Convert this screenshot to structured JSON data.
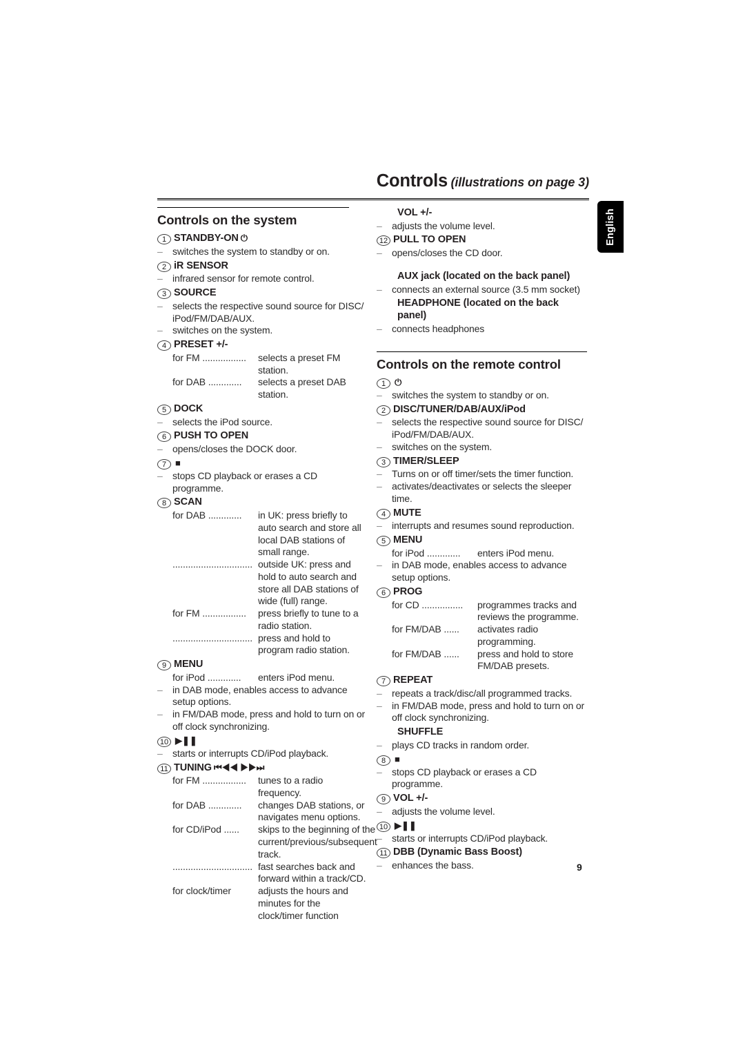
{
  "header": {
    "title": "Controls",
    "subtitle": "(illustrations on page 3)"
  },
  "language_tab": {
    "label": "English"
  },
  "page_number": "9",
  "left_column": {
    "section_title": "Controls on the system",
    "entries": [
      {
        "num": "1",
        "label": "STANDBY-ON",
        "glyph": "⏻",
        "lines": [
          {
            "dash": "–",
            "text": "switches the system to standby or on."
          }
        ]
      },
      {
        "num": "2",
        "label": "iR SENSOR",
        "lines": [
          {
            "dash": "–",
            "text": "infrared sensor for remote control."
          }
        ]
      },
      {
        "num": "3",
        "label": "SOURCE",
        "lines": [
          {
            "dash": "–",
            "text": "selects the respective sound source for DISC/ iPod/FM/DAB/AUX."
          },
          {
            "dash": "–",
            "text": "switches on the system."
          }
        ]
      },
      {
        "num": "4",
        "label": "PRESET +/-",
        "leaders": [
          {
            "term": "for FM .................",
            "desc": "selects a preset FM station."
          },
          {
            "term": "for DAB .............",
            "desc": "selects a preset DAB station."
          }
        ]
      },
      {
        "num": "5",
        "label": "DOCK",
        "lines": [
          {
            "dash": "–",
            "text": "selects the iPod source."
          }
        ]
      },
      {
        "num": "6",
        "label": "PUSH TO OPEN",
        "lines": [
          {
            "dash": "–",
            "text": "opens/closes the DOCK door."
          }
        ]
      },
      {
        "num": "7",
        "label": "",
        "glyph": "■",
        "lines": [
          {
            "dash": "–",
            "text": "stops CD playback or erases a CD programme."
          }
        ]
      },
      {
        "num": "8",
        "label": "SCAN",
        "leaders": [
          {
            "term": "for DAB .............",
            "desc": "in UK: press briefly to auto search and store all local DAB stations of small range."
          },
          {
            "term": "...............................",
            "desc": "outside UK: press and hold to auto search and store all DAB stations of wide (full) range."
          },
          {
            "term": "for FM .................",
            "desc": "press briefly to tune to a radio station."
          },
          {
            "term": "...............................",
            "desc": "press and hold to program radio station."
          }
        ]
      },
      {
        "num": "9",
        "label": "MENU",
        "leaders": [
          {
            "term": "for iPod .............",
            "desc": "enters iPod menu."
          }
        ],
        "lines": [
          {
            "dash": "–",
            "text": "in DAB mode, enables access to advance setup options."
          },
          {
            "dash": "–",
            "text": "in FM/DAB mode, press and hold to turn on or off clock synchronizing."
          }
        ]
      },
      {
        "num": "10",
        "label": "",
        "glyph": "▶❚❚",
        "lines": [
          {
            "dash": "–",
            "text": "starts or interrupts CD/iPod playback."
          }
        ]
      },
      {
        "num": "11",
        "label": "TUNING",
        "glyph": "⏮◀◀  ▶▶⏭",
        "leaders": [
          {
            "term": "for FM .................",
            "desc": "tunes to a radio frequency."
          },
          {
            "term": "for DAB .............",
            "desc": "changes DAB stations, or navigates menu options."
          },
          {
            "term": "for CD/iPod ......",
            "desc": "skips to the beginning of the current/previous/subsequent track."
          },
          {
            "term": "...............................",
            "desc": "fast searches back and forward within a track/CD."
          },
          {
            "term": "for clock/timer",
            "desc": "adjusts the hours and minutes for the clock/timer function"
          }
        ]
      }
    ]
  },
  "right_column": {
    "top_entries": [
      {
        "num": "",
        "label": "VOL +/-",
        "lines": [
          {
            "dash": "–",
            "text": "adjusts the volume level."
          }
        ]
      },
      {
        "num": "12",
        "label": "PULL TO OPEN",
        "lines": [
          {
            "dash": "–",
            "text": "opens/closes the CD door."
          }
        ]
      },
      {
        "num": "",
        "label": "AUX jack (located on the back panel)",
        "lines": [
          {
            "dash": "–",
            "text": "connects an external source (3.5 mm socket)"
          }
        ]
      },
      {
        "num": "",
        "label": "HEADPHONE (located on the back panel)",
        "lines": [
          {
            "dash": "–",
            "text": "connects headphones"
          }
        ]
      }
    ],
    "section_title": "Controls on the remote control",
    "entries": [
      {
        "num": "1",
        "label": "",
        "glyph": "⏻",
        "lines": [
          {
            "dash": "–",
            "text": "switches the system to standby or on."
          }
        ]
      },
      {
        "num": "2",
        "label": "DISC/TUNER/DAB/AUX/iPod",
        "lines": [
          {
            "dash": "–",
            "text": "selects the respective sound source for DISC/ iPod/FM/DAB/AUX."
          },
          {
            "dash": "–",
            "text": "switches on the system."
          }
        ]
      },
      {
        "num": "3",
        "label": "TIMER/SLEEP",
        "lines": [
          {
            "dash": "–",
            "text": "Turns on or off timer/sets the timer function."
          },
          {
            "dash": "–",
            "text": "activates/deactivates or selects the sleeper time."
          }
        ]
      },
      {
        "num": "4",
        "label": "MUTE",
        "lines": [
          {
            "dash": "–",
            "text": "interrupts and resumes sound reproduction."
          }
        ]
      },
      {
        "num": "5",
        "label": "MENU",
        "leaders": [
          {
            "term": "for iPod .............",
            "desc": "enters iPod menu."
          }
        ],
        "lines": [
          {
            "dash": "–",
            "text": "in DAB mode, enables access to advance setup options."
          }
        ]
      },
      {
        "num": "6",
        "label": "PROG",
        "leaders": [
          {
            "term": "for CD ................",
            "desc": "programmes tracks and reviews the programme."
          },
          {
            "term": "for FM/DAB ......",
            "desc": "activates radio programming."
          },
          {
            "term": "for FM/DAB ......",
            "desc": "press and hold to store FM/DAB presets."
          }
        ]
      },
      {
        "num": "7",
        "label": "REPEAT",
        "lines": [
          {
            "dash": "–",
            "text": "repeats a track/disc/all programmed tracks."
          },
          {
            "dash": "–",
            "text": "in FM/DAB mode, press and hold to turn on or off clock synchronizing."
          }
        ]
      },
      {
        "num": "",
        "label": "SHUFFLE",
        "lines": [
          {
            "dash": "–",
            "text": "plays CD tracks in random order."
          }
        ]
      },
      {
        "num": "8",
        "label": "",
        "glyph": "■",
        "lines": [
          {
            "dash": "–",
            "text": "stops CD playback or erases a CD programme."
          }
        ]
      },
      {
        "num": "9",
        "label": "VOL +/-",
        "lines": [
          {
            "dash": "–",
            "text": "adjusts the volume level."
          }
        ]
      },
      {
        "num": "10",
        "label": "",
        "glyph": "▶❚❚",
        "lines": [
          {
            "dash": "–",
            "text": "starts or interrupts CD/iPod playback."
          }
        ]
      },
      {
        "num": "11",
        "label": "DBB (Dynamic Bass Boost)",
        "lines": [
          {
            "dash": "–",
            "text": "enhances the bass."
          }
        ]
      }
    ]
  }
}
